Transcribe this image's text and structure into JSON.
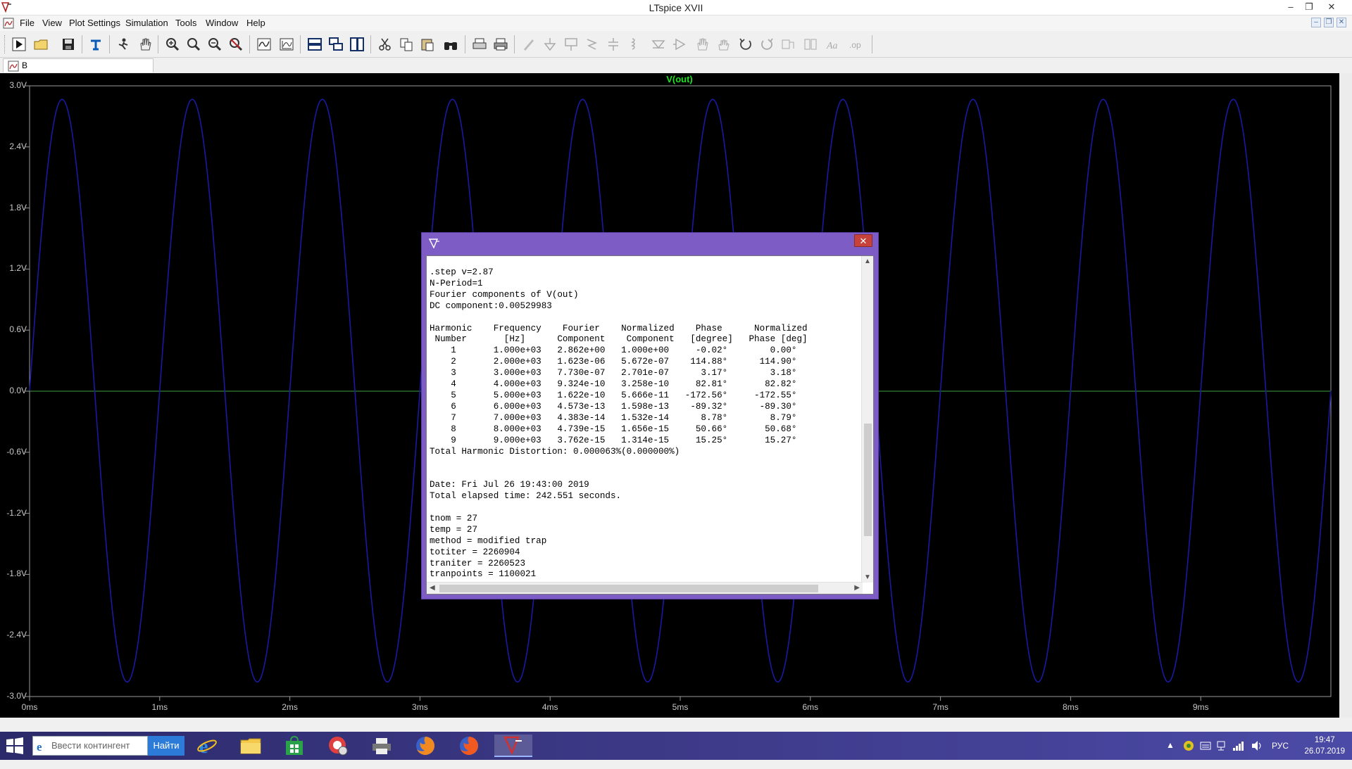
{
  "window": {
    "title": "LTspice XVII",
    "minimize": "–",
    "restore": "❐",
    "close": "✕"
  },
  "menu": {
    "items": [
      "File",
      "View",
      "Plot Settings",
      "Simulation",
      "Tools",
      "Window",
      "Help"
    ],
    "mdi_min": "–",
    "mdi_restore": "❐",
    "mdi_close": "✕"
  },
  "toolbar": {
    "buttons": [
      "run",
      "open",
      "save",
      "halt",
      "autorange",
      "pan",
      "zoom-in",
      "zoom-out",
      "zoom-out-small",
      "zoom-cancel",
      "plot-grid",
      "plot-settings",
      "tile-horizontal",
      "cascade",
      "tile-vertical",
      "cut",
      "copy",
      "paste",
      "find",
      "print",
      "print-setup",
      "wire",
      "ground",
      "label",
      "resistor",
      "capacitor",
      "inductor",
      "diode",
      "component",
      "move",
      "drag",
      "undo",
      "redo",
      "rotate",
      "mirror",
      "text",
      "spice-directive"
    ]
  },
  "tab": {
    "label": "B"
  },
  "plot": {
    "trace_name": "V(out)",
    "trace_color": "#1a1aa0",
    "zero_line_color": "#40a040",
    "y_ticks": [
      "3.0V",
      "2.4V",
      "1.8V",
      "1.2V",
      "0.6V",
      "0.0V",
      "-0.6V",
      "-1.2V",
      "-1.8V",
      "-2.4V",
      "-3.0V"
    ],
    "x_ticks": [
      "0ms",
      "1ms",
      "2ms",
      "3ms",
      "4ms",
      "5ms",
      "6ms",
      "7ms",
      "8ms",
      "9ms"
    ]
  },
  "chart_data": {
    "type": "line",
    "title": "V(out)",
    "xlabel": "",
    "ylabel": "",
    "xlim": [
      0,
      10
    ],
    "ylim": [
      -3.0,
      3.0
    ],
    "x_unit": "ms",
    "y_unit": "V",
    "grid": false,
    "series": [
      {
        "name": "V(out)",
        "function": "sine",
        "amplitude": 2.862,
        "frequency_khz": 1.0,
        "offset": 0.00529983,
        "phase_deg": -0.02
      }
    ]
  },
  "dialog": {
    "close": "✕",
    "lines": [
      ".step v=2.87",
      "N-Period=1",
      "Fourier components of V(out)",
      "DC component:0.00529983",
      "",
      "Harmonic    Frequency    Fourier    Normalized    Phase      Normalized",
      " Number       [Hz]      Component    Component   [degree]   Phase [deg]",
      "    1       1.000e+03   2.862e+00   1.000e+00     -0.02°        0.00°",
      "    2       2.000e+03   1.623e-06   5.672e-07    114.88°      114.90°",
      "    3       3.000e+03   7.730e-07   2.701e-07      3.17°        3.18°",
      "    4       4.000e+03   9.324e-10   3.258e-10     82.81°       82.82°",
      "    5       5.000e+03   1.622e-10   5.666e-11   -172.56°     -172.55°",
      "    6       6.000e+03   4.573e-13   1.598e-13    -89.32°      -89.30°",
      "    7       7.000e+03   4.383e-14   1.532e-14      8.78°        8.79°",
      "    8       8.000e+03   4.739e-15   1.656e-15     50.66°       50.68°",
      "    9       9.000e+03   3.762e-15   1.314e-15     15.25°       15.27°",
      "Total Harmonic Distortion: 0.000063%(0.000000%)",
      "",
      "",
      "Date: Fri Jul 26 19:43:00 2019",
      "Total elapsed time: 242.551 seconds.",
      "",
      "tnom = 27",
      "temp = 27",
      "method = modified trap",
      "totiter = 2260904",
      "traniter = 2260523",
      "tranpoints = 1100021"
    ]
  },
  "taskbar": {
    "search_placeholder": "Ввести контингент",
    "search_button": "Найти",
    "language": "РУС",
    "time": "19:47",
    "date": "26.07.2019"
  }
}
